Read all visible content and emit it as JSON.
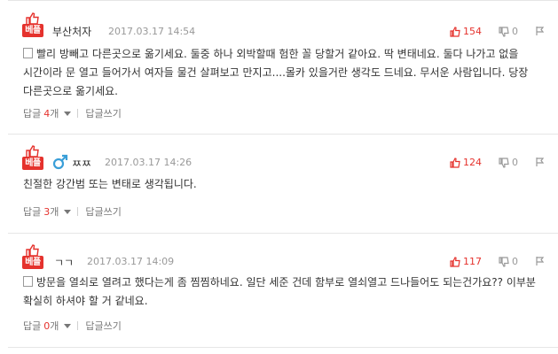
{
  "labels": {
    "best_badge": "베플",
    "reply": "답글",
    "reply_unit": "개",
    "write_reply": "답글쓰기"
  },
  "colors": {
    "accent": "#e5322d",
    "gender_male": "#3a9fd8"
  },
  "comments": [
    {
      "author": "부산처자",
      "date": "2017.03.17 14:54",
      "gender_icon": "",
      "body": "빨리 방빼고 다른곳으로 옮기세요. 둘중 하나 외박할때 험한 꼴 당할거 같아요. 딱 변태네요. 둘다 나가고 없을 시간이라 문 열고 들어가서 여자들 물건 살펴보고 만지고....몰카 있을거란 생각도 드네요. 무서운 사람입니다. 당장 다른곳으로 옮기세요.",
      "likes": "154",
      "dislikes": "0",
      "reply_count": "4"
    },
    {
      "author": "ㅉㅉ",
      "date": "2017.03.17 14:26",
      "gender_icon": "male-icon",
      "body": "친절한 강간범 또는 변태로 생각됩니다.",
      "likes": "124",
      "dislikes": "0",
      "reply_count": "3"
    },
    {
      "author": "ㄱㄱ",
      "date": "2017.03.17 14:09",
      "gender_icon": "",
      "body": "방문을 열쇠로 열려고 했다는게 좀 찜찜하네요. 일단 세준 건데 함부로 열쇠열고 드나들어도 되는건가요?? 이부분 확실히 하셔야 할 거 같네요.",
      "likes": "117",
      "dislikes": "0",
      "reply_count": "0"
    }
  ]
}
